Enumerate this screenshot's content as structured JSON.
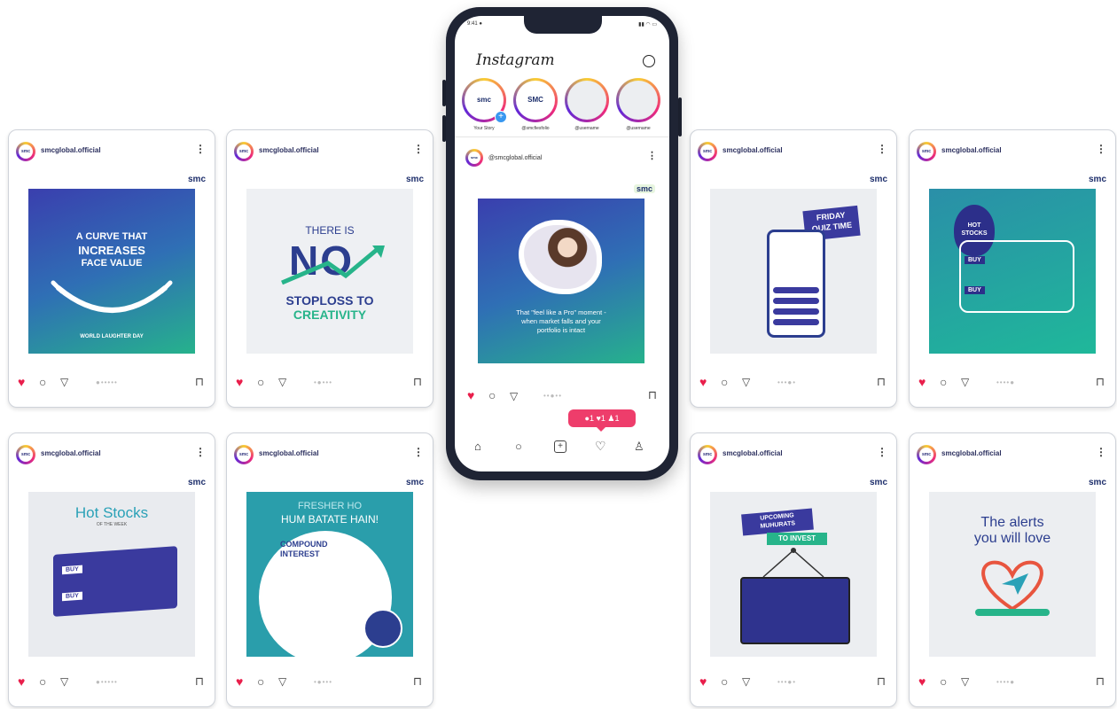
{
  "brand": {
    "name": "smc",
    "suffix": "c"
  },
  "phone": {
    "app_title": "Instagram",
    "stories": [
      {
        "label": "Your Story",
        "logo": "smc"
      },
      {
        "label": "@smcfiesfolio",
        "logo": "SMC"
      },
      {
        "label": "@username",
        "logo": ""
      },
      {
        "label": "@username",
        "logo": ""
      }
    ],
    "post_handle": "@smcglobal.official",
    "post_caption_1": "That \"feel like a Pro\" moment -",
    "post_caption_2": "when market falls and your",
    "post_caption_3": "portfolio is intact",
    "notifications": {
      "comments": "1",
      "likes": "1",
      "followers": "1"
    },
    "accent": "#e91e4b"
  },
  "cards": [
    {
      "handle": "smcglobal.official",
      "lines": [
        "A CURVE THAT",
        "INCREASES",
        "FACE VALUE"
      ],
      "foot": "WORLD LAUGHTER DAY"
    },
    {
      "handle": "smcglobal.official",
      "lines": [
        "THERE IS",
        "NO",
        "STOPLOSS TO",
        "CREATIVITY"
      ]
    },
    {
      "handle": "smcglobal.official",
      "lines": [
        "FRIDAY",
        "QUIZ TIME"
      ]
    },
    {
      "handle": "smcglobal.official",
      "lines": [
        "HOT",
        "STOCKS",
        "BUY",
        "BUY"
      ]
    },
    {
      "handle": "smcglobal.official",
      "lines": [
        "Hot Stocks",
        "OF THE WEEK",
        "BUY",
        "BUY"
      ]
    },
    {
      "handle": "smcglobal.official",
      "lines": [
        "FRESHER HO",
        "HUM BATATE HAIN!",
        "COMPOUND",
        "INTEREST"
      ]
    },
    {
      "handle": "smcglobal.official",
      "lines": [
        "UPCOMING",
        "MUHURATS",
        "TO INVEST"
      ]
    },
    {
      "handle": "smcglobal.official",
      "lines": [
        "The alerts",
        "you will love"
      ]
    }
  ]
}
